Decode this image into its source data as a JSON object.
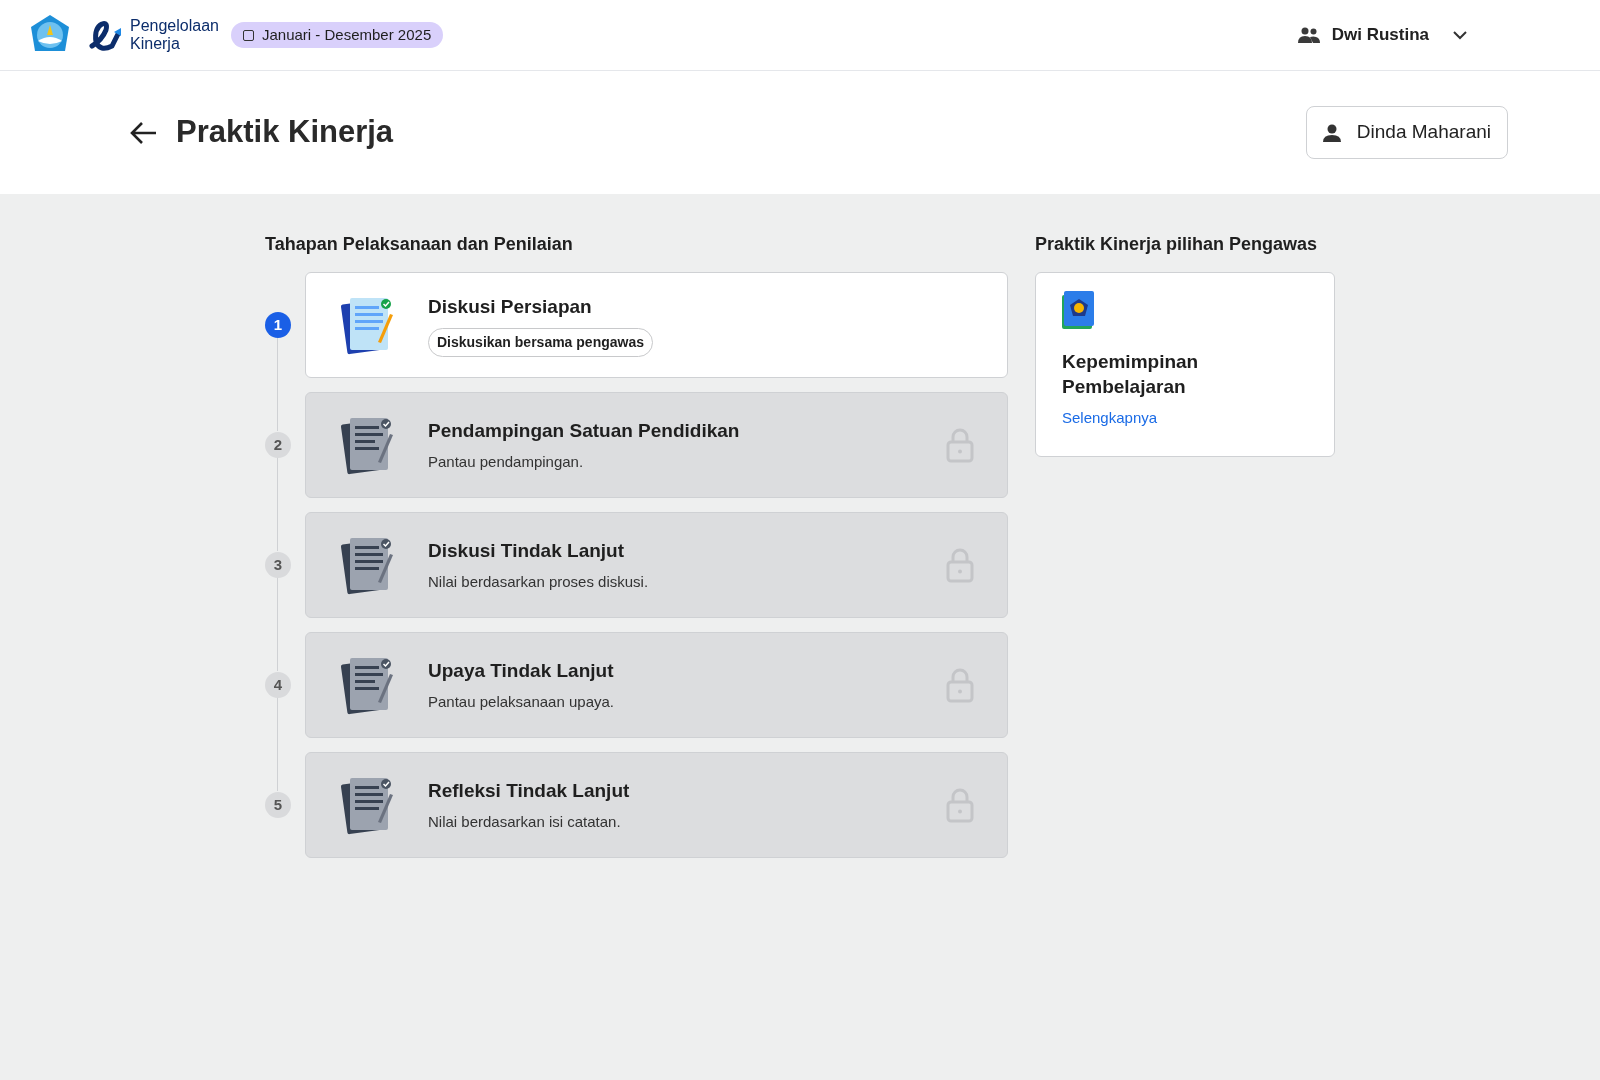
{
  "header": {
    "brand": "Pengelolaan\nKinerja",
    "period": "Januari - Desember 2025",
    "user": "Dwi Rustina"
  },
  "page": {
    "title": "Praktik Kinerja",
    "person": "Dinda Maharani"
  },
  "stages": {
    "title": "Tahapan Pelaksanaan dan Penilaian",
    "steps": [
      {
        "number": "1",
        "title": "Diskusi Persiapan",
        "subtitle": "Diskusikan bersama pengawas",
        "kind": "badge",
        "locked": false
      },
      {
        "number": "2",
        "title": "Pendampingan Satuan Pendidikan",
        "subtitle": "Pantau pendampingan.",
        "kind": "note",
        "locked": true
      },
      {
        "number": "3",
        "title": "Diskusi Tindak Lanjut",
        "subtitle": "Nilai berdasarkan proses diskusi.",
        "kind": "note",
        "locked": true
      },
      {
        "number": "4",
        "title": "Upaya Tindak Lanjut",
        "subtitle": "Pantau pelaksanaan upaya.",
        "kind": "note",
        "locked": true
      },
      {
        "number": "5",
        "title": "Refleksi Tindak Lanjut",
        "subtitle": "Nilai berdasarkan isi catatan.",
        "kind": "note",
        "locked": true
      }
    ]
  },
  "choice": {
    "title": "Praktik Kinerja pilihan Pengawas",
    "card_title": "Kepemimpinan Pembelajaran",
    "link": "Selengkapnya"
  }
}
